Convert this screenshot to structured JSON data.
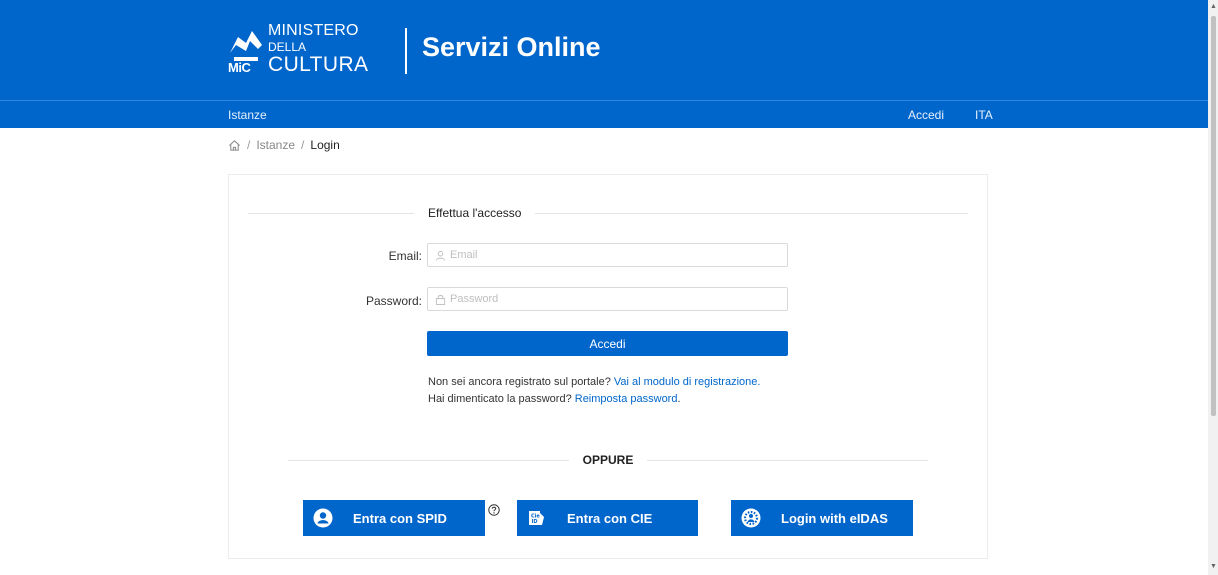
{
  "header": {
    "logo": {
      "line1": "MINISTERO",
      "line2": "DELLA",
      "line3": "CULTURA",
      "mark": "MiC"
    },
    "title": "Servizi Online"
  },
  "navbar": {
    "left": "Istanze",
    "right": [
      "Accedi",
      "ITA"
    ]
  },
  "breadcrumb": {
    "items": [
      "Istanze",
      "Login"
    ]
  },
  "form": {
    "heading": "Effettua l'accesso",
    "email": {
      "label": "Email",
      "placeholder": "Email",
      "value": ""
    },
    "password": {
      "label": "Password",
      "placeholder": "Password",
      "value": ""
    },
    "submit": "Accedi",
    "register_text": "Non sei ancora registrato sul portale?",
    "register_link": "Vai al modulo di registrazione.",
    "forgot_text": "Hai dimenticato la password?",
    "forgot_link": "Reimposta password",
    "forgot_end": "."
  },
  "alt": {
    "divider": "OPPURE",
    "spid": "Entra con SPID",
    "cie": "Entra con CIE",
    "eidas": "Login with eIDAS"
  },
  "colors": {
    "primary": "#0066cc"
  }
}
